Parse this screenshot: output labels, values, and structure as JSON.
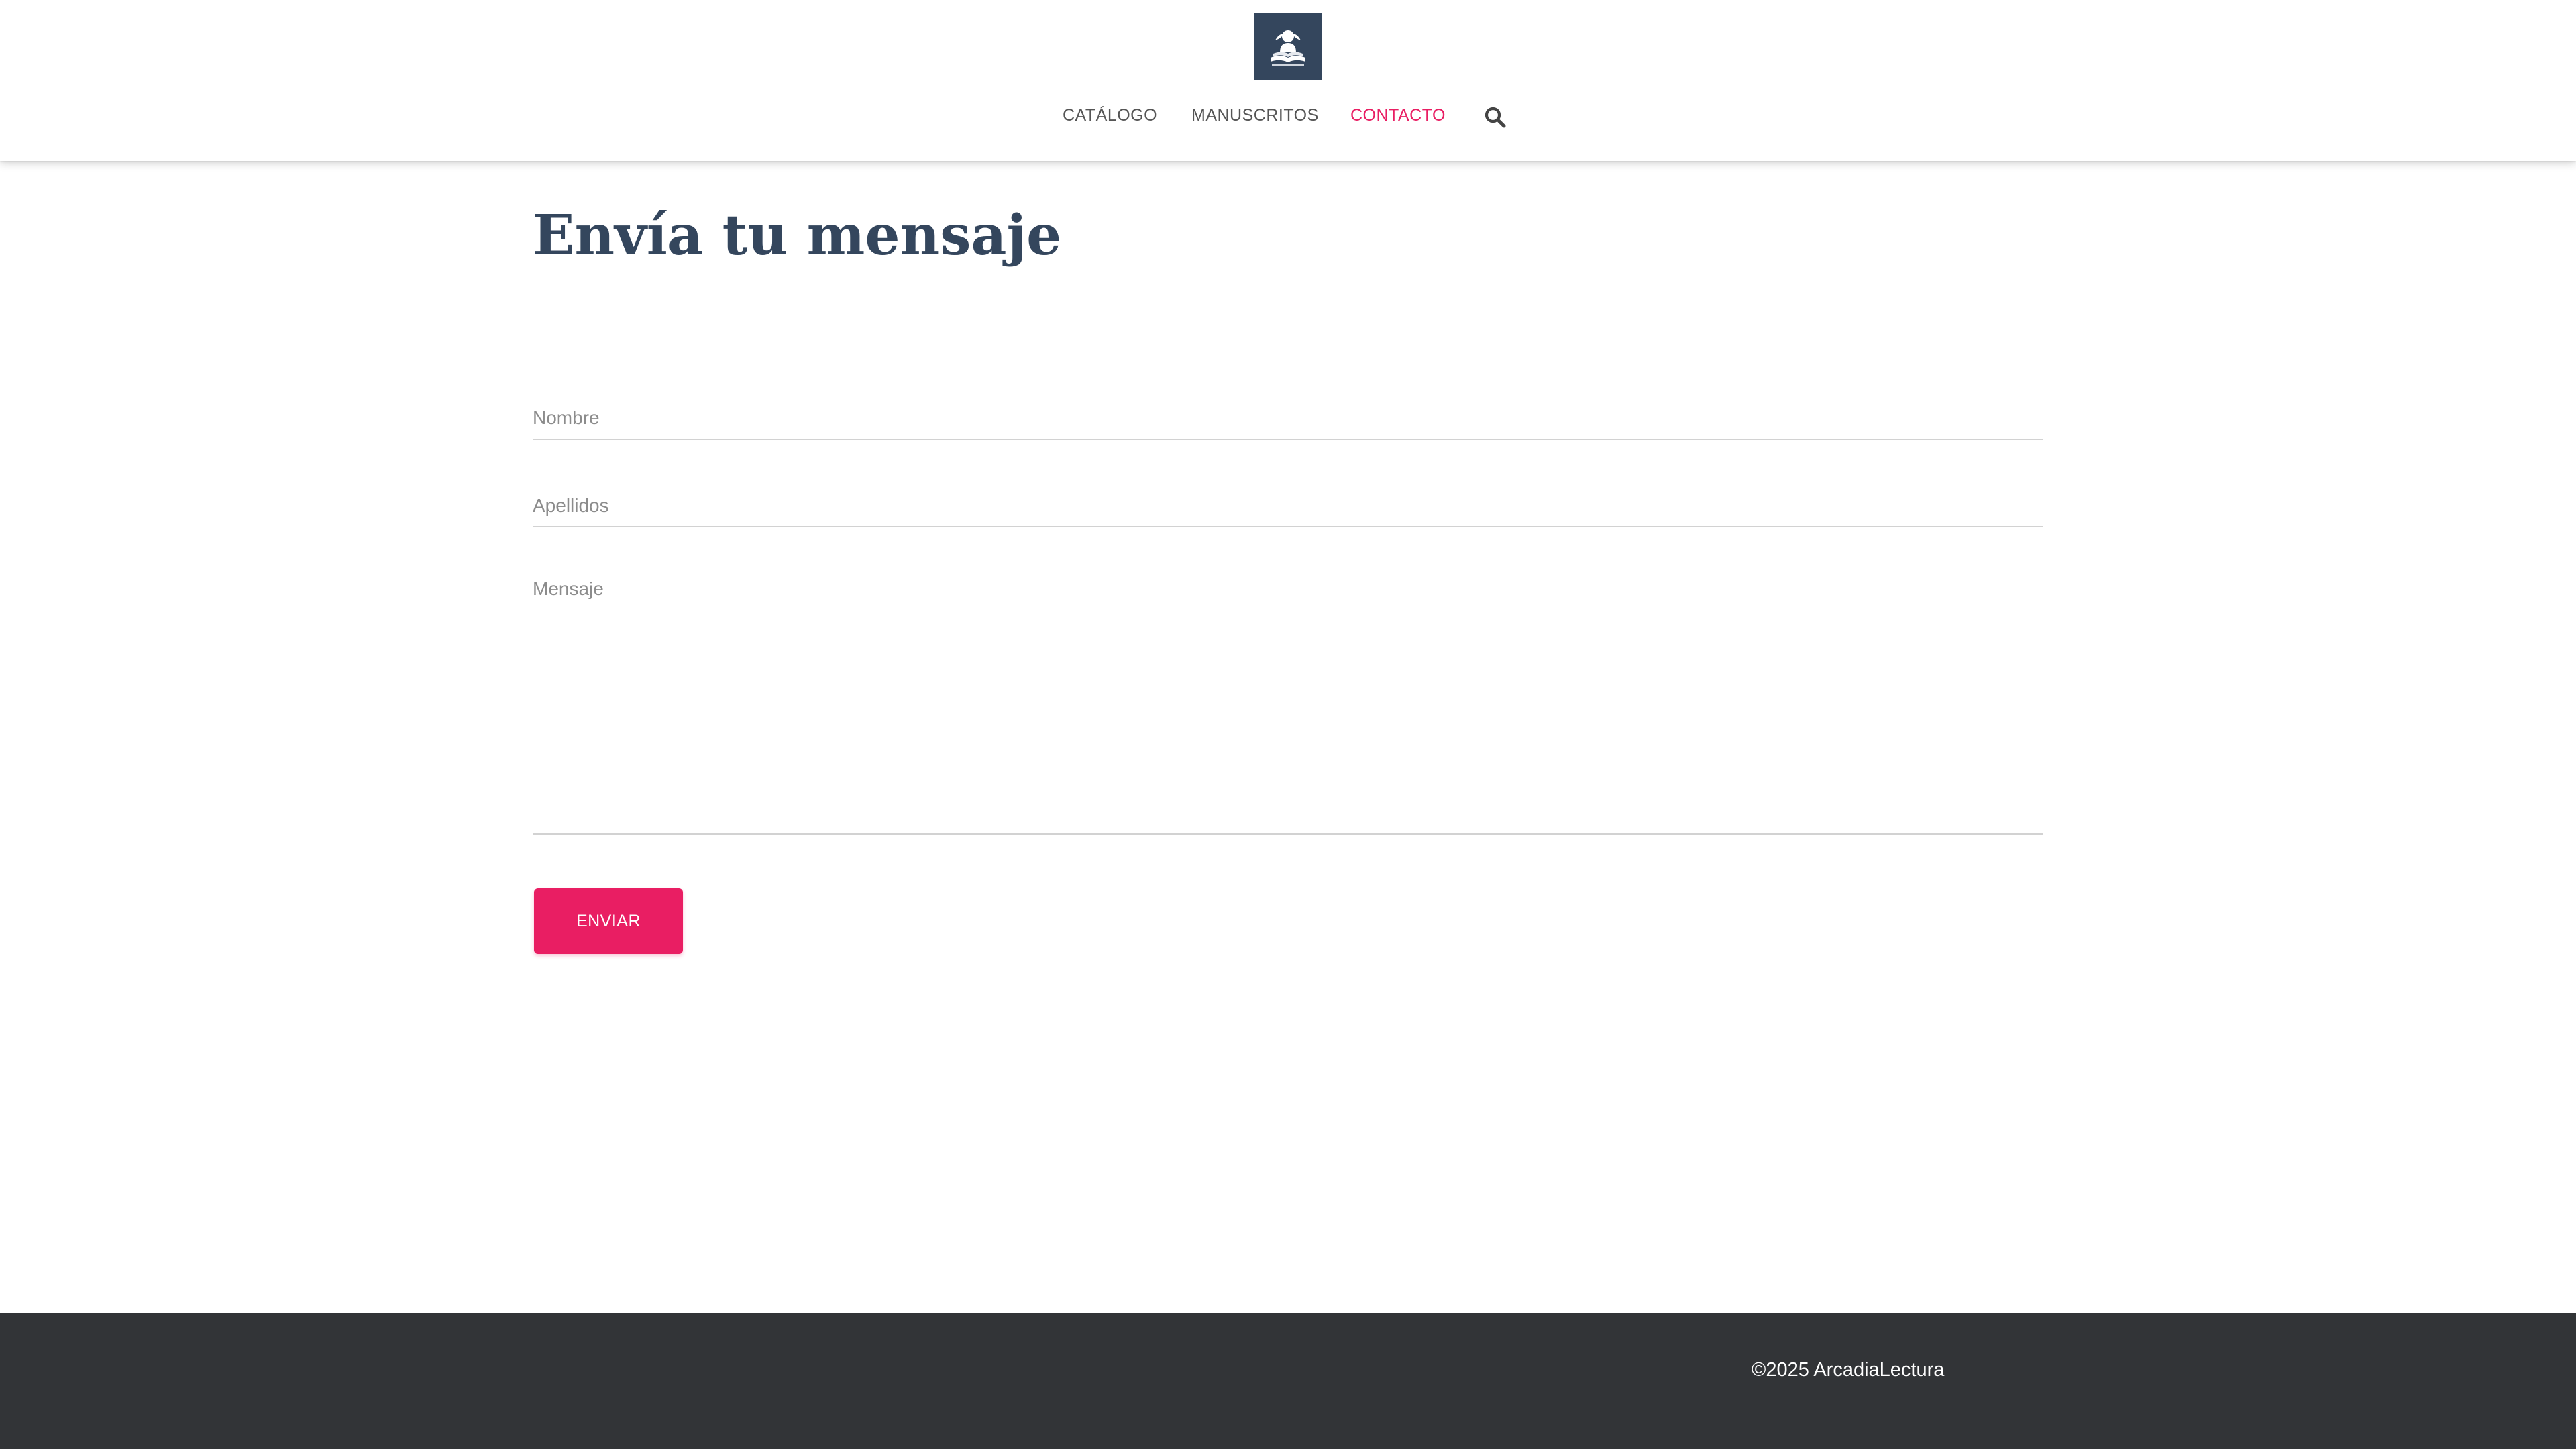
{
  "header": {
    "logo": {
      "icon": "book-reader-logo",
      "background_color": "#34465d"
    },
    "nav": [
      {
        "label": "CATÁLOGO",
        "active": false
      },
      {
        "label": "MANUSCRITOS",
        "active": false
      },
      {
        "label": "CONTACTO",
        "active": true
      }
    ],
    "search": {
      "icon": "search-icon"
    }
  },
  "main": {
    "title": "Envía tu mensaje",
    "form": {
      "first_name_placeholder": "Nombre",
      "last_name_placeholder": "Apellidos",
      "message_placeholder": "Mensaje",
      "submit_label": "ENVIAR"
    }
  },
  "footer": {
    "copyright": "©2025 ArcadiaLectura"
  },
  "colors": {
    "accent": "#e91e63",
    "heading": "#34465d",
    "nav_text": "#555555",
    "footer_bg": "#323437"
  }
}
